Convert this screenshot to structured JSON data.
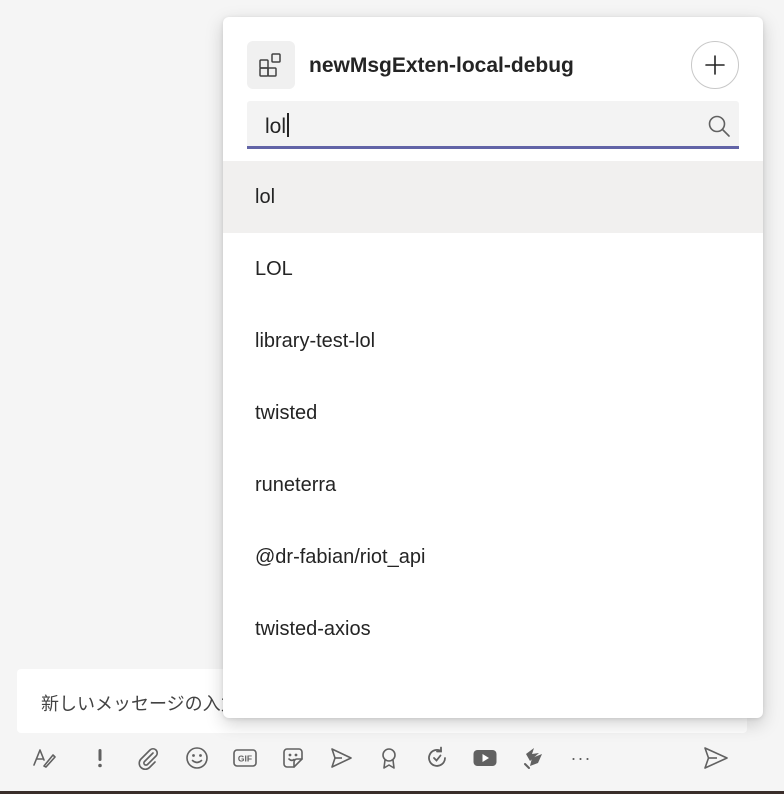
{
  "compose": {
    "placeholder": "新しいメッセージの入力"
  },
  "toolbar": {
    "icons": [
      "format-icon",
      "important-icon",
      "attach-icon",
      "emoji-icon",
      "gif-icon",
      "sticker-icon",
      "meet-now-icon",
      "praise-icon",
      "loop-icon",
      "video-icon",
      "extension-icon",
      "more-options-icon"
    ],
    "gif_label": "GIF",
    "more_label": "···"
  },
  "popup": {
    "app_title": "newMsgExten-local-debug",
    "search_value": "lol",
    "results": [
      "lol",
      "LOL",
      "library-test-lol",
      "twisted",
      "runeterra",
      "@dr-fabian/riot_api",
      "twisted-axios"
    ],
    "active_index": 0
  },
  "colors": {
    "accent": "#6264a7",
    "background": "#f5f5f5",
    "hover": "#f1f0ef"
  }
}
